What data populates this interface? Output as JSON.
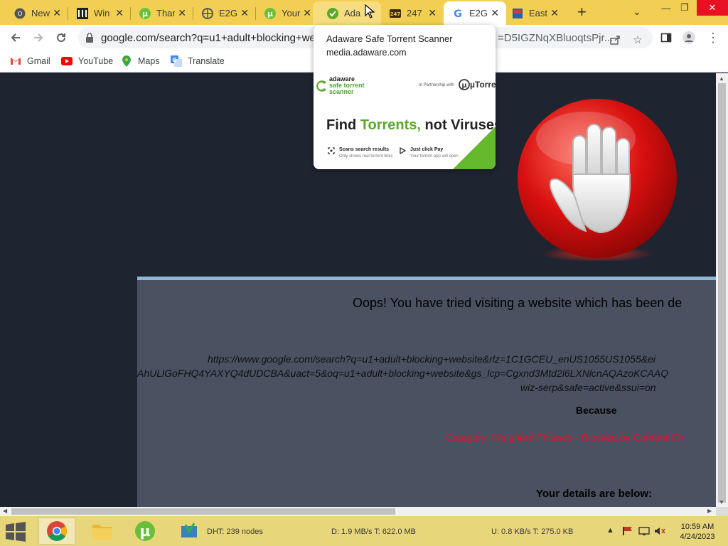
{
  "tabs": [
    {
      "title": "New",
      "icon": "chrome-icon",
      "active": false
    },
    {
      "title": "Win",
      "icon": "museum-icon",
      "active": false
    },
    {
      "title": "Thar",
      "icon": "utorrent-icon",
      "active": false
    },
    {
      "title": "E2G",
      "icon": "globe-icon",
      "active": false
    },
    {
      "title": "Your",
      "icon": "utorrent-icon",
      "active": false
    },
    {
      "title": "Ada",
      "icon": "adaware-icon",
      "active": false
    },
    {
      "title": "247",
      "icon": "247-icon",
      "active": false
    },
    {
      "title": "E2G",
      "icon": "google-icon",
      "active": true
    },
    {
      "title": "East",
      "icon": "east-icon",
      "active": false
    }
  ],
  "toolbar": {
    "url": "google.com/search?q=u1+adult+blocking+webs",
    "url_tail": "=D5IGZNqXBluoqtsPjr..."
  },
  "bookmarks": [
    {
      "label": "Gmail",
      "icon": "gmail-icon"
    },
    {
      "label": "YouTube",
      "icon": "youtube-icon"
    },
    {
      "label": "Maps",
      "icon": "maps-icon"
    },
    {
      "label": "Translate",
      "icon": "translate-icon"
    }
  ],
  "hovercard": {
    "title": "Adaware Safe Torrent Scanner",
    "domain": "media.adaware.com",
    "preview": {
      "brand_line1": "adaware",
      "brand_line2": "safe torrent",
      "brand_line3": "scanner",
      "partner": "In Partnership with",
      "utorrent": "µTorrent",
      "headline_a": "Find ",
      "headline_b": "Torrents,",
      "headline_c": " not Viruses",
      "feature1": "Scans search results",
      "feature1_sub": "Only shows real torrent links",
      "feature2": "Just click Pay",
      "feature2_sub": "Your torrent app will open"
    }
  },
  "blockpage": {
    "headline": "Oops! You have tried visiting a website which has been de",
    "url_line1": "https://www.google.com/search?q=u1+adult+blocking+website&rlz=1C1GCEU_enUS1055US1055&ei",
    "url_line2": "AhULlGoFHQ4YAXYQ4dUDCBA&uact=5&oq=u1+adult+blocking+website&gs_lcp=Cgxnd3Mtd2l6LXNlcnAQAzoKCAAQ",
    "url_line3": "wiz-serp&safe=active&ssui=on",
    "because": "Because",
    "category": "Category: Weighted Phrases - Blocked by Content Ch",
    "details": "Your details are below:"
  },
  "taskbar": {
    "dht": "DHT: 239 nodes",
    "download": "D: 1.9 MB/s T: 622.0 MB",
    "upload": "U: 0.8 KB/s T: 275.0 KB",
    "time": "10:59 AM",
    "date": "4/24/2023"
  },
  "colors": {
    "tabstrip": "#f2cf52",
    "taskbar": "#e8d67a",
    "page_bg": "#1e2430",
    "panel_bg": "#4a5160",
    "blocked_red": "#e8112d"
  }
}
